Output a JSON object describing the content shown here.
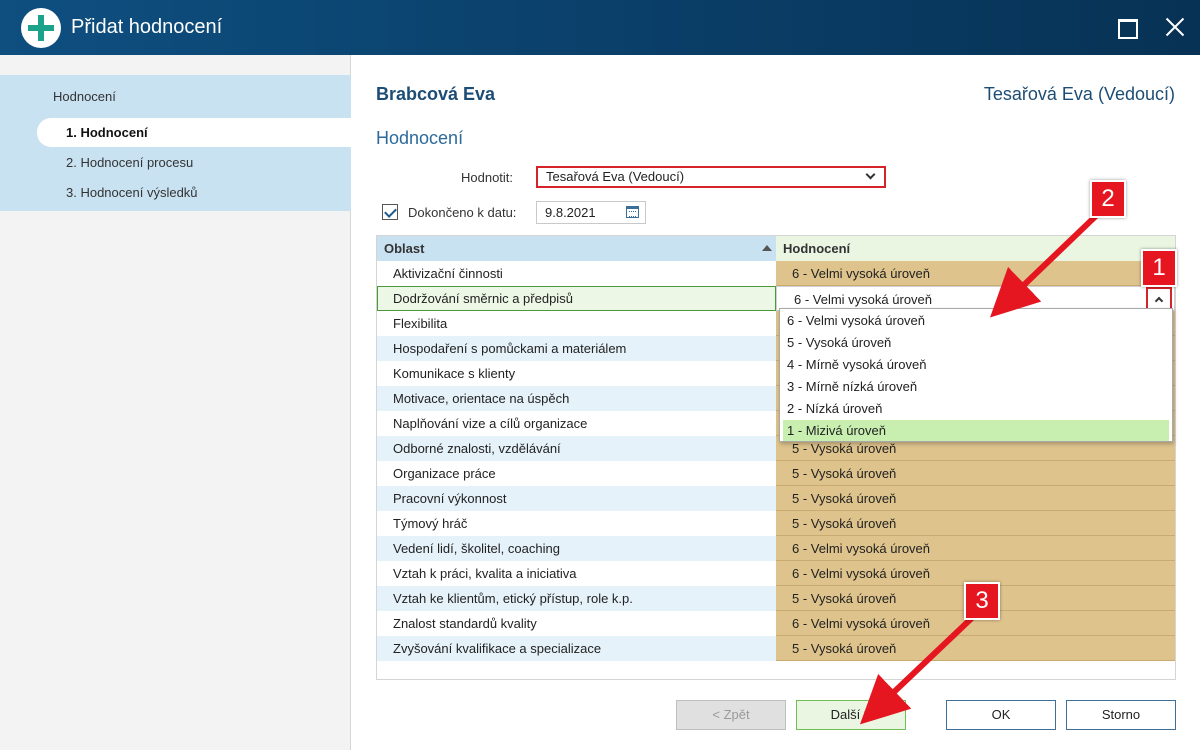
{
  "window": {
    "title": "Přidat hodnocení"
  },
  "sidebar": {
    "title": "Hodnocení",
    "items": [
      {
        "label": "1. Hodnocení",
        "active": true
      },
      {
        "label": "2. Hodnocení procesu",
        "active": false
      },
      {
        "label": "3. Hodnocení výsledků",
        "active": false
      }
    ]
  },
  "header": {
    "employee": "Brabcová Eva",
    "manager": "Tesařová Eva (Vedoucí)",
    "section": "Hodnocení"
  },
  "form": {
    "evaluator_label": "Hodnotit:",
    "evaluator_value": "Tesařová Eva (Vedoucí)",
    "completed_label": "Dokončeno k datu:",
    "completed_checked": true,
    "date_value": "9.8.2021"
  },
  "grid": {
    "columns": [
      "Oblast",
      "Hodnocení"
    ],
    "rows": [
      {
        "area": "Aktivizační činnosti",
        "rating": "6 - Velmi vysoká úroveň"
      },
      {
        "area": "Dodržování směrnic a předpisů",
        "rating": "6 - Velmi vysoká úroveň"
      },
      {
        "area": "Flexibilita",
        "rating": ""
      },
      {
        "area": "Hospodaření s pomůckami a materiálem",
        "rating": ""
      },
      {
        "area": "Komunikace s klienty",
        "rating": ""
      },
      {
        "area": "Motivace, orientace na úspěch",
        "rating": ""
      },
      {
        "area": "Naplňování vize a cílů organizace",
        "rating": ""
      },
      {
        "area": "Odborné znalosti, vzdělávání",
        "rating": "5 - Vysoká úroveň"
      },
      {
        "area": "Organizace práce",
        "rating": "5 - Vysoká úroveň"
      },
      {
        "area": "Pracovní výkonnost",
        "rating": "5 - Vysoká úroveň"
      },
      {
        "area": "Týmový hráč",
        "rating": "5 - Vysoká úroveň"
      },
      {
        "area": "Vedení lidí, školitel, coaching",
        "rating": "6 - Velmi vysoká úroveň"
      },
      {
        "area": "Vztah k práci, kvalita a iniciativa",
        "rating": "6 - Velmi vysoká úroveň"
      },
      {
        "area": "Vztah ke klientům, etický přístup, role k.p.",
        "rating": "5 - Vysoká úroveň"
      },
      {
        "area": "Znalost standardů kvality",
        "rating": "6 - Velmi vysoká úroveň"
      },
      {
        "area": "Zvyšování kvalifikace a specializace",
        "rating": "5 - Vysoká úroveň"
      }
    ],
    "dropdown_options": [
      "6 - Velmi vysoká úroveň",
      "5 - Vysoká úroveň",
      "4 - Mírně vysoká úroveň",
      "3 - Mírně nízká úroveň",
      "2 - Nízká úroveň",
      "1 - Mizivá úroveň"
    ],
    "highlighted_option": "1 - Mizivá úroveň"
  },
  "buttons": {
    "back": "< Zpět",
    "next": "Další >",
    "ok": "OK",
    "cancel": "Storno"
  },
  "callouts": [
    "1",
    "2",
    "3"
  ],
  "colors": {
    "titlebar": "#0e4f80",
    "rating_cell": "#dec38c",
    "highlight": "#c9efb0",
    "callout": "#e5161f"
  }
}
